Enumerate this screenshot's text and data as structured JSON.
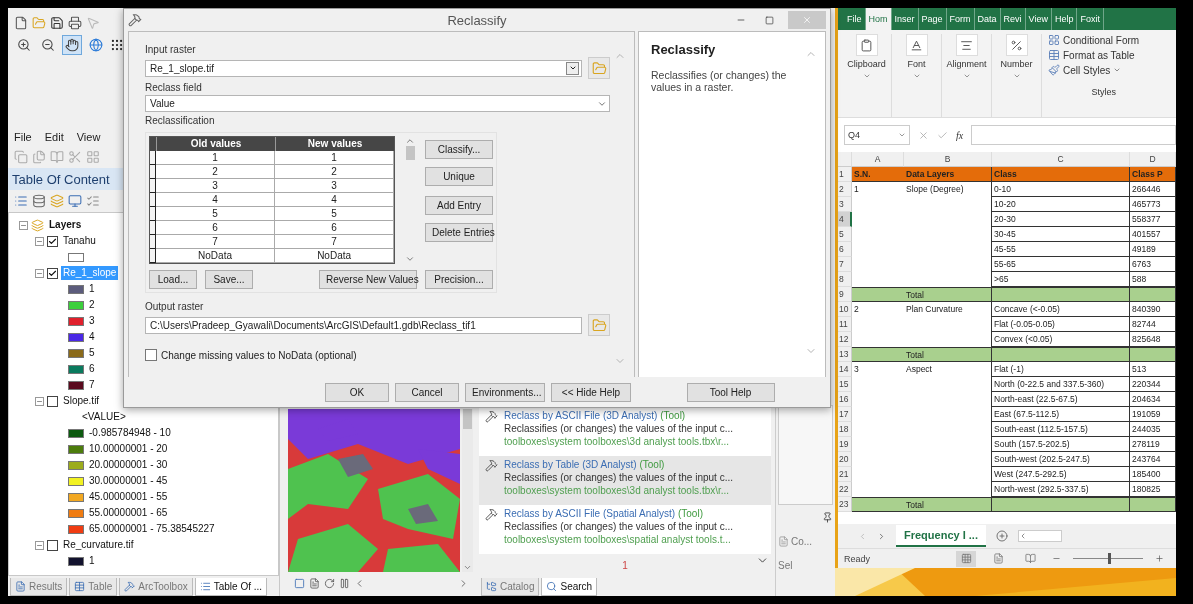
{
  "arcmap": {
    "map_tools": [
      {
        "kind": "zoom-in",
        "selected": false
      },
      {
        "kind": "zoom-out",
        "selected": false
      },
      {
        "kind": "pan",
        "selected": true
      },
      {
        "kind": "globe",
        "selected": false
      }
    ],
    "menu": [
      "File",
      "Edit",
      "View"
    ],
    "toc": {
      "title": "Table Of Content",
      "tree": [
        {
          "kind": "group",
          "label": "Layers",
          "expanded": true,
          "children": [
            {
              "kind": "layer",
              "label": "Tanahu",
              "checked": true,
              "expanded": true,
              "selected": false,
              "children": [
                {
                  "kind": "legend",
                  "color": "#ffffff"
                }
              ]
            },
            {
              "kind": "layer",
              "label": "Re_1_slope",
              "checked": true,
              "expanded": true,
              "selected": true,
              "children": [
                {
                  "kind": "legend",
                  "label": "1",
                  "color": "#5c5c7c"
                },
                {
                  "kind": "legend",
                  "label": "2",
                  "color": "#3ccf3c"
                },
                {
                  "kind": "legend",
                  "label": "3",
                  "color": "#e0202c"
                },
                {
                  "kind": "legend",
                  "label": "4",
                  "color": "#4a28e6"
                },
                {
                  "kind": "legend",
                  "label": "5",
                  "color": "#8a6a1a"
                },
                {
                  "kind": "legend",
                  "label": "6",
                  "color": "#0a7a5e"
                },
                {
                  "kind": "legend",
                  "label": "7",
                  "color": "#5a0a1e"
                }
              ]
            },
            {
              "kind": "layer",
              "label": "Slope.tif",
              "checked": false,
              "expanded": true,
              "selected": false,
              "children": [
                {
                  "kind": "heading",
                  "label": "<VALUE>"
                },
                {
                  "kind": "legend",
                  "label": "-0.985784948 - 10",
                  "color": "#0c5a10"
                },
                {
                  "kind": "legend",
                  "label": "10.00000001 - 20",
                  "color": "#4c7c0c"
                },
                {
                  "kind": "legend",
                  "label": "20.00000001 - 30",
                  "color": "#9cac1c"
                },
                {
                  "kind": "legend",
                  "label": "30.00000001 - 45",
                  "color": "#f2f222"
                },
                {
                  "kind": "legend",
                  "label": "45.00000001 - 55",
                  "color": "#f2a822"
                },
                {
                  "kind": "legend",
                  "label": "55.00000001 - 65",
                  "color": "#f07c12"
                },
                {
                  "kind": "legend",
                  "label": "65.00000001 - 75.38545227",
                  "color": "#f03c12"
                }
              ]
            },
            {
              "kind": "layer",
              "label": "Re_curvature.tif",
              "checked": false,
              "expanded": true,
              "selected": false,
              "children": [
                {
                  "kind": "legend",
                  "label": "1",
                  "color": "#12122e"
                }
              ]
            }
          ]
        }
      ]
    },
    "left_tabs": [
      {
        "label": "Results",
        "selected": false
      },
      {
        "label": "Table",
        "selected": false
      },
      {
        "label": "ArcToolbox",
        "selected": false
      },
      {
        "label": "Table Of ...",
        "selected": true
      }
    ],
    "search_results": [
      {
        "title": "Reclass by ASCII File (3D Analyst)",
        "type": "(Tool)",
        "description": "Reclassifies (or changes) the values of the input c...",
        "path": "toolboxes\\system toolboxes\\3d analyst tools.tbx\\r...",
        "selected": false
      },
      {
        "title": "Reclass by Table (3D Analyst)",
        "type": "(Tool)",
        "description": "Reclassifies (or changes) the values of the input c...",
        "path": "toolboxes\\system toolboxes\\3d analyst tools.tbx\\r...",
        "selected": true
      },
      {
        "title": "Reclass by ASCII File (Spatial Analyst)",
        "type": "(Tool)",
        "description": "Reclassifies (or changes) the values of the input c...",
        "path": "toolboxes\\system toolboxes\\spatial analyst tools.t...",
        "selected": false
      }
    ],
    "page_number": "1",
    "side_panel": [
      "Co...",
      "Sel"
    ],
    "catalog_tabs": [
      {
        "label": "Catalog",
        "selected": false
      },
      {
        "label": "Search",
        "selected": true
      }
    ]
  },
  "dialog": {
    "title": "Reclassify",
    "input_label": "Input raster",
    "input_value": "Re_1_slope.tif",
    "field_label": "Reclass field",
    "field_value": "Value",
    "reclass_label": "Reclassification",
    "columns": [
      "Old values",
      "New values"
    ],
    "rows": [
      {
        "old": "1",
        "new": "1"
      },
      {
        "old": "2",
        "new": "2"
      },
      {
        "old": "3",
        "new": "3"
      },
      {
        "old": "4",
        "new": "4"
      },
      {
        "old": "5",
        "new": "5"
      },
      {
        "old": "6",
        "new": "6"
      },
      {
        "old": "7",
        "new": "7"
      },
      {
        "old": "NoData",
        "new": "NoData"
      }
    ],
    "side_buttons": [
      "Classify...",
      "Unique",
      "Add Entry",
      "Delete Entries"
    ],
    "table_buttons": [
      "Load...",
      "Save...",
      "Reverse New Values",
      "Precision..."
    ],
    "output_label": "Output raster",
    "output_value": "C:\\Users\\Pradeep_Gyawali\\Documents\\ArcGIS\\Default1.gdb\\Reclass_tif1",
    "nodata_option": {
      "label": "Change missing values to NoData (optional)",
      "checked": false
    },
    "help_title": "Reclassify",
    "help_text": "Reclassifies (or changes) the values in a raster.",
    "footer_buttons": [
      "OK",
      "Cancel",
      "Environments...",
      "<< Hide Help"
    ],
    "help_button": "Tool Help"
  },
  "excel": {
    "tabs": [
      {
        "label": "File",
        "selected": false
      },
      {
        "label": "Hom",
        "selected": true
      },
      {
        "label": "Inser",
        "selected": false
      },
      {
        "label": "Page",
        "selected": false
      },
      {
        "label": "Form",
        "selected": false
      },
      {
        "label": "Data",
        "selected": false
      },
      {
        "label": "Revi",
        "selected": false
      },
      {
        "label": "View",
        "selected": false
      },
      {
        "label": "Help",
        "selected": false
      },
      {
        "label": "Foxit",
        "selected": false
      }
    ],
    "ribbon_groups": [
      {
        "kind": "clipboard",
        "label": "Clipboard"
      },
      {
        "kind": "font",
        "label": "Font"
      },
      {
        "kind": "alignment",
        "label": "Alignment"
      },
      {
        "kind": "number",
        "label": "Number"
      }
    ],
    "styles": {
      "items": [
        {
          "kind": "conditional",
          "label": "Conditional Form"
        },
        {
          "kind": "table",
          "label": "Format as Table"
        },
        {
          "kind": "cell",
          "label": "Cell Styles",
          "menu": true
        }
      ],
      "label": "Styles"
    },
    "name_box": "Q4",
    "function_label": "fx",
    "columns": [
      "A",
      "B",
      "C",
      "D"
    ],
    "rows": [
      {
        "num": "1",
        "kind": "header",
        "selected": false,
        "a": "S.N.",
        "b": "Data Layers",
        "c": "Class",
        "d": "Class P"
      },
      {
        "num": "2",
        "kind": "data",
        "selected": false,
        "a": "1",
        "b": "Slope (Degree)",
        "c": "0-10",
        "d": "266446"
      },
      {
        "num": "3",
        "kind": "data",
        "selected": false,
        "c": "10-20",
        "d": "465773"
      },
      {
        "num": "4",
        "kind": "data",
        "selected": true,
        "c": "20-30",
        "d": "558377"
      },
      {
        "num": "5",
        "kind": "data",
        "selected": false,
        "c": "30-45",
        "d": "401557"
      },
      {
        "num": "6",
        "kind": "data",
        "selected": false,
        "c": "45-55",
        "d": "49189"
      },
      {
        "num": "7",
        "kind": "data",
        "selected": false,
        "c": "55-65",
        "d": "6763"
      },
      {
        "num": "8",
        "kind": "data",
        "selected": false,
        "c": ">65",
        "d": "588"
      },
      {
        "num": "9",
        "kind": "total",
        "selected": false,
        "b": "Total"
      },
      {
        "num": "10",
        "kind": "data",
        "selected": false,
        "a": "2",
        "b": "Plan Curvature",
        "c": "Concave (<-0.05)",
        "d": "840390"
      },
      {
        "num": "11",
        "kind": "data",
        "selected": false,
        "c": "Flat (-0.05-0.05)",
        "d": "82744"
      },
      {
        "num": "12",
        "kind": "data",
        "selected": false,
        "c": "Convex (<0.05)",
        "d": "825648"
      },
      {
        "num": "13",
        "kind": "total",
        "selected": false,
        "b": "Total"
      },
      {
        "num": "14",
        "kind": "data",
        "selected": false,
        "a": "3",
        "b": "Aspect",
        "c": "Flat (-1)",
        "d": "513"
      },
      {
        "num": "15",
        "kind": "data",
        "selected": false,
        "c": "North (0-22.5 and 337.5-360)",
        "d": "220344"
      },
      {
        "num": "16",
        "kind": "data",
        "selected": false,
        "c": "North-east (22.5-67.5)",
        "d": "204634"
      },
      {
        "num": "17",
        "kind": "data",
        "selected": false,
        "c": "East (67.5-112.5)",
        "d": "191059"
      },
      {
        "num": "18",
        "kind": "data",
        "selected": false,
        "c": "South-east (112.5-157.5)",
        "d": "244035"
      },
      {
        "num": "19",
        "kind": "data",
        "selected": false,
        "c": "South (157.5-202.5)",
        "d": "278119"
      },
      {
        "num": "20",
        "kind": "data",
        "selected": false,
        "c": "South-west (202.5-247.5)",
        "d": "243764"
      },
      {
        "num": "21",
        "kind": "data",
        "selected": false,
        "c": "West (247.5-292.5)",
        "d": "185400"
      },
      {
        "num": "22",
        "kind": "data",
        "selected": false,
        "c": "North-west (292.5-337.5)",
        "d": "180825"
      },
      {
        "num": "23",
        "kind": "total",
        "selected": false,
        "b": "Total"
      }
    ],
    "sheet_tabs": [
      {
        "label": "Frequency I ...",
        "selected": true
      }
    ],
    "status": {
      "text": "Ready",
      "views": [
        {
          "selected": true
        },
        {
          "selected": false
        },
        {
          "selected": false
        }
      ],
      "zoom": {
        "level": 0.5
      }
    }
  }
}
